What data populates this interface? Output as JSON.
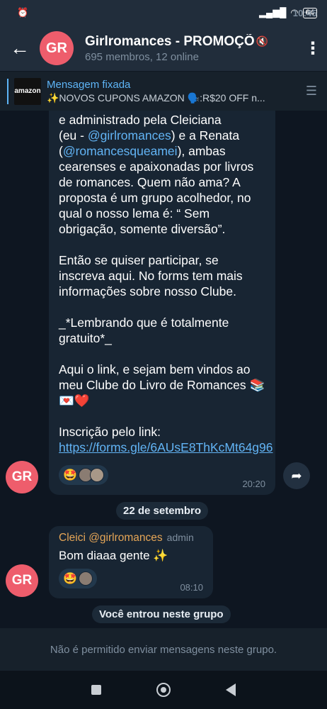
{
  "status": {
    "time": "10:45",
    "alarm_icon": "alarm-icon",
    "battery": "64"
  },
  "header": {
    "title": "Girlromances - PROMOÇÕ",
    "subtitle": "695 membros, 12 online",
    "avatar_initials": "GR",
    "avatar_color": "#ee5d6c"
  },
  "pinned": {
    "label": "Mensagem fixada",
    "thumb_text": "amazon",
    "text": "✨NOVOS CUPONS AMAZON 🗣️:R$20 OFF n..."
  },
  "message1": {
    "lines_part1": "e administrado pela Cleiciana",
    "part2_prefix": "(eu - ",
    "mention1": "@girlromances",
    "part2_mid": ") e a Renata",
    "part3_prefix": "(",
    "mention2": "@romancesqueamei",
    "part3_suffix": "), ambas",
    "part4": "cearenses e apaixonadas por livros de romances. Quem não ama? A proposta é um grupo acolhedor, no qual o nosso lema é: “ Sem obrigação, somente diversão”.",
    "para2": "Então se quiser participar, se inscreva aqui. No forms tem mais informações sobre nosso Clube.",
    "para3": "_*Lembrando que é totalmente gratuito*_",
    "para4": "Aqui o link, e sejam bem vindos ao meu Clube do Livro de Romances 📚💌❤️",
    "link_prefix": "Inscrição pelo link: ",
    "link": "https://forms.gle/6AUsE8ThKcMt64g96",
    "reaction_emoji": "🤩",
    "time": "20:20"
  },
  "date_separator": "22 de setembro",
  "message2": {
    "sender": "Cleici @girlromances",
    "role": "admin",
    "text": "Bom diaaa gente ✨",
    "reaction_emoji": "🤩",
    "time": "08:10"
  },
  "system_message": "Você entrou neste grupo",
  "footer": {
    "notice": "Não é permitido enviar mensagens neste grupo."
  }
}
